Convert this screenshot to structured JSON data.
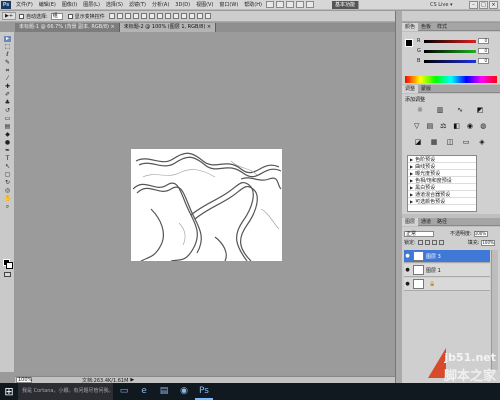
{
  "menubar": {
    "logo": "Ps",
    "items": [
      "文件(F)",
      "编辑(E)",
      "图像(I)",
      "图层(L)",
      "选择(S)",
      "滤镜(T)",
      "分析(A)",
      "3D(D)",
      "视图(V)",
      "窗口(W)",
      "帮助(H)"
    ],
    "workspace": "基本功能",
    "cs_live": "CS Live ▾",
    "window_buttons": [
      "–",
      "□",
      "×"
    ]
  },
  "options_bar": {
    "tool_label": "▶+",
    "auto_select_label": "自动选择:",
    "auto_select_value": "组",
    "show_transform_label": "显示变换控件"
  },
  "tabs": [
    {
      "label": "未标题-1 @ 66.7% (背景 副本, RGB/8) ×",
      "active": false
    },
    {
      "label": "未标题-2 @ 100% (图层 1, RGB/8) ×",
      "active": true
    }
  ],
  "color_panel": {
    "tabs": [
      "颜色",
      "色板",
      "样式"
    ],
    "sliders": [
      {
        "label": "R",
        "value": "0",
        "color": "#e02020"
      },
      {
        "label": "G",
        "value": "0",
        "color": "#20b020"
      },
      {
        "label": "B",
        "value": "0",
        "color": "#2030e0"
      }
    ]
  },
  "adjust_panel": {
    "tabs": [
      "调整",
      "蒙版"
    ],
    "title": "添加调整",
    "presets": [
      "色阶预设",
      "曲线预设",
      "曝光度预设",
      "色相/饱和度预设",
      "黑白预设",
      "通道混合器预设",
      "可选颜色预设"
    ]
  },
  "layers_panel": {
    "tabs": [
      "图层",
      "通道",
      "路径"
    ],
    "blend_mode": "正常",
    "opacity_label": "不透明度:",
    "opacity": "100%",
    "lock_label": "锁定:",
    "fill_label": "填充:",
    "fill": "100%",
    "layers": [
      {
        "name": "图层 3",
        "selected": true,
        "locked": false
      },
      {
        "name": "图层 1",
        "selected": false,
        "locked": false
      },
      {
        "name": "",
        "selected": false,
        "locked": true
      }
    ]
  },
  "status": {
    "zoom": "100%",
    "docinfo": "文档:263.4K/1.61M"
  },
  "taskbar": {
    "cortana": "我是 Cortana，小娜。有问题尽管问我。"
  },
  "watermark": {
    "url": "jb51.net",
    "name": "脚本之家"
  }
}
